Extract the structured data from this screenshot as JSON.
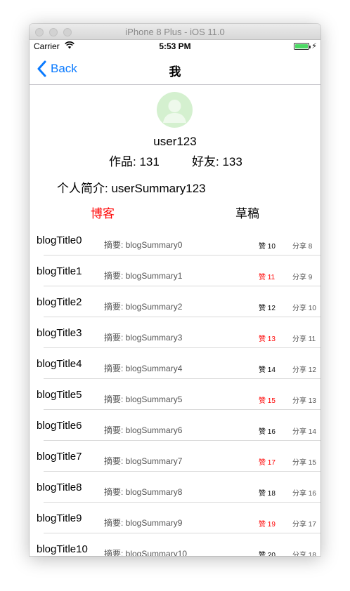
{
  "window": {
    "title": "iPhone 8 Plus - iOS 11.0"
  },
  "status": {
    "carrier": "Carrier",
    "time": "5:53 PM",
    "battery_level": 1.0
  },
  "nav": {
    "back": "Back",
    "title": "我"
  },
  "profile": {
    "username": "user123",
    "works": "作品: 131",
    "friends": "好友: 133",
    "summary": "个人简介: userSummary123"
  },
  "tabs": {
    "blog": "博客",
    "draft": "草稿",
    "active": "blog"
  },
  "colors": {
    "accent": "#0a7aff",
    "active_tab": "#ff0000",
    "avatar_bg": "#d4f0cf",
    "battery": "#4cd964"
  },
  "rows": [
    {
      "title": "blogTitle0",
      "summary": "摘要: blogSummary0",
      "likes": "赞 10",
      "shares": "分享 8",
      "likes_red": false
    },
    {
      "title": "blogTitle1",
      "summary": "摘要: blogSummary1",
      "likes": "赞 11",
      "shares": "分享 9",
      "likes_red": true
    },
    {
      "title": "blogTitle2",
      "summary": "摘要: blogSummary2",
      "likes": "赞 12",
      "shares": "分享 10",
      "likes_red": false
    },
    {
      "title": "blogTitle3",
      "summary": "摘要: blogSummary3",
      "likes": "赞 13",
      "shares": "分享 11",
      "likes_red": true
    },
    {
      "title": "blogTitle4",
      "summary": "摘要: blogSummary4",
      "likes": "赞 14",
      "shares": "分享 12",
      "likes_red": false
    },
    {
      "title": "blogTitle5",
      "summary": "摘要: blogSummary5",
      "likes": "赞 15",
      "shares": "分享 13",
      "likes_red": true
    },
    {
      "title": "blogTitle6",
      "summary": "摘要: blogSummary6",
      "likes": "赞 16",
      "shares": "分享 14",
      "likes_red": false
    },
    {
      "title": "blogTitle7",
      "summary": "摘要: blogSummary7",
      "likes": "赞 17",
      "shares": "分享 15",
      "likes_red": true
    },
    {
      "title": "blogTitle8",
      "summary": "摘要: blogSummary8",
      "likes": "赞 18",
      "shares": "分享 16",
      "likes_red": false
    },
    {
      "title": "blogTitle9",
      "summary": "摘要: blogSummary9",
      "likes": "赞 19",
      "shares": "分享 17",
      "likes_red": true
    },
    {
      "title": "blogTitle10",
      "summary": "摘要: blogSummary10",
      "likes": "赞 20",
      "shares": "分享 18",
      "likes_red": false
    }
  ]
}
